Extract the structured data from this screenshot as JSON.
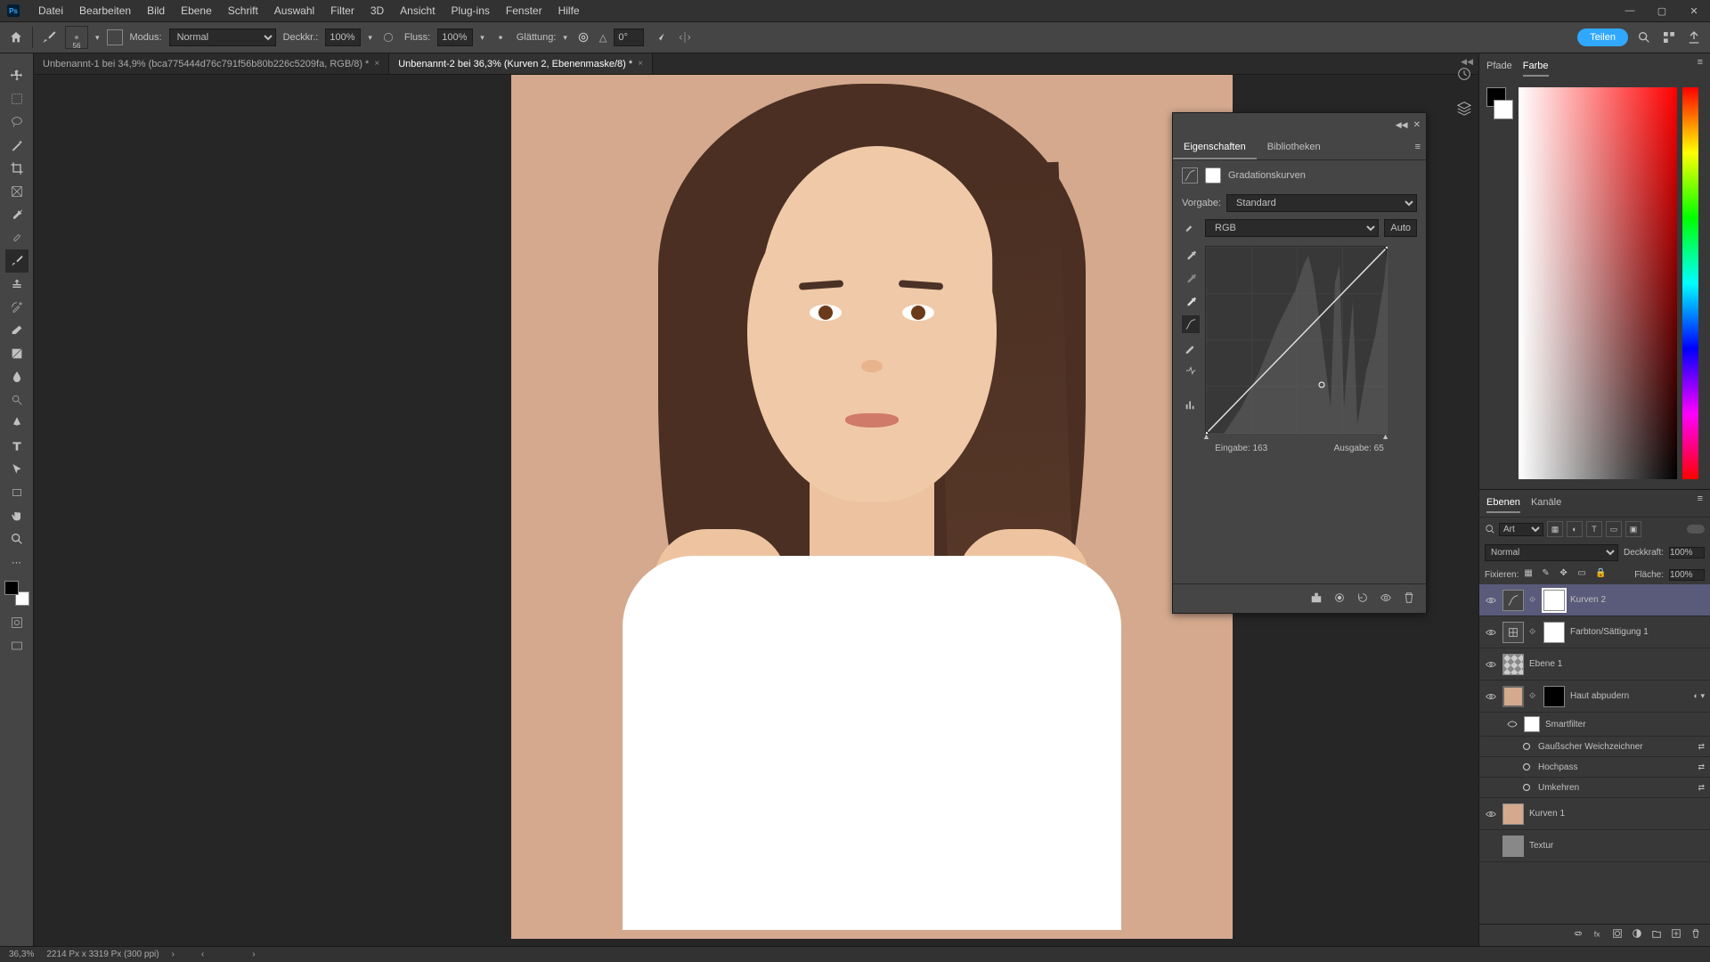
{
  "menu": [
    "Datei",
    "Bearbeiten",
    "Bild",
    "Ebene",
    "Schrift",
    "Auswahl",
    "Filter",
    "3D",
    "Ansicht",
    "Plug-ins",
    "Fenster",
    "Hilfe"
  ],
  "options": {
    "brush_size": "56",
    "modus_label": "Modus:",
    "modus_value": "Normal",
    "deckkraft_label": "Deckkr.:",
    "deckkraft_value": "100%",
    "fluss_label": "Fluss:",
    "fluss_value": "100%",
    "glaettung_label": "Glättung:",
    "angle_label": "△",
    "angle_value": "0°",
    "share": "Teilen"
  },
  "tabs": [
    {
      "label": "Unbenannt-1 bei 34,9% (bca775444d76c791f56b80b226c5209fa, RGB/8) *",
      "active": false
    },
    {
      "label": "Unbenannt-2 bei 36,3% (Kurven 2, Ebenenmaske/8) *",
      "active": true
    }
  ],
  "properties": {
    "tab_eigenschaften": "Eigenschaften",
    "tab_bibliotheken": "Bibliotheken",
    "adj_name": "Gradationskurven",
    "vorgabe_label": "Vorgabe:",
    "vorgabe_value": "Standard",
    "channel": "RGB",
    "auto": "Auto",
    "eingabe_label": "Eingabe:",
    "eingabe_value": "163",
    "ausgabe_label": "Ausgabe:",
    "ausgabe_value": "65"
  },
  "color_tabs": {
    "pfade": "Pfade",
    "farbe": "Farbe"
  },
  "layers": {
    "tab_ebenen": "Ebenen",
    "tab_kanaele": "Kanäle",
    "filter_label": "Art",
    "blend_mode": "Normal",
    "deckkraft_label": "Deckkraft:",
    "deckkraft_value": "100%",
    "fixieren_label": "Fixieren:",
    "flaeche_label": "Fläche:",
    "flaeche_value": "100%",
    "items": [
      {
        "name": "Kurven 2"
      },
      {
        "name": "Farbton/Sättigung 1"
      },
      {
        "name": "Ebene 1"
      },
      {
        "name": "Haut abpudern"
      },
      {
        "name": "Smartfilter"
      },
      {
        "name": "Gaußscher Weichzeichner"
      },
      {
        "name": "Hochpass"
      },
      {
        "name": "Umkehren"
      },
      {
        "name": "Kurven 1"
      },
      {
        "name": "Textur"
      }
    ]
  },
  "status": {
    "zoom": "36,3%",
    "doc_info": "2214 Px x 3319 Px (300 ppi)"
  }
}
